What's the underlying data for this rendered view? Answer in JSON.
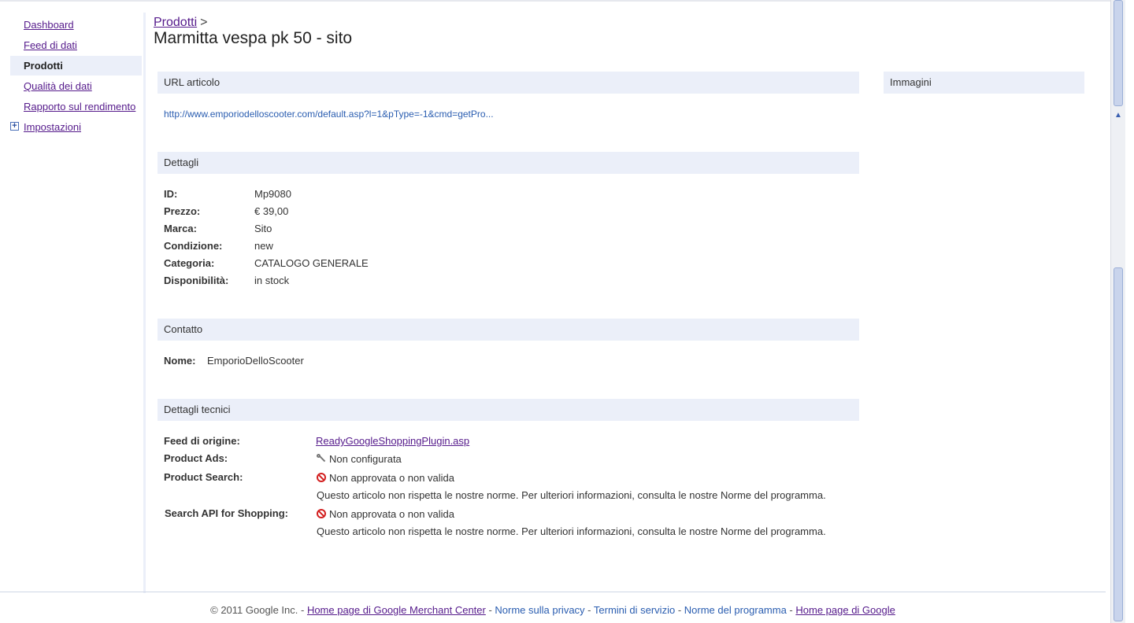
{
  "sidebar": {
    "items": [
      {
        "label": "Dashboard"
      },
      {
        "label": "Feed di dati"
      },
      {
        "label": "Prodotti"
      },
      {
        "label": "Qualità dei dati"
      },
      {
        "label": "Rapporto sul rendimento"
      },
      {
        "label": "Impostazioni"
      }
    ]
  },
  "header": {
    "breadcrumb": "Prodotti",
    "breadcrumb_sep": ">",
    "title": "Marmitta vespa pk 50 - sito"
  },
  "url_section": {
    "title": "URL articolo",
    "url": "http://www.emporiodelloscooter.com/default.asp?l=1&pType=-1&cmd=getPro..."
  },
  "images_section": {
    "title": "Immagini"
  },
  "details": {
    "title": "Dettagli",
    "rows": [
      {
        "label": "ID:",
        "value": "Mp9080"
      },
      {
        "label": "Prezzo:",
        "value": "€ 39,00"
      },
      {
        "label": "Marca:",
        "value": "Sito"
      },
      {
        "label": "Condizione:",
        "value": "new"
      },
      {
        "label": "Categoria:",
        "value": "CATALOGO GENERALE"
      },
      {
        "label": "Disponibilità:",
        "value": "in stock"
      }
    ]
  },
  "contact": {
    "title": "Contatto",
    "label": "Nome:",
    "value": "EmporioDelloScooter"
  },
  "technical": {
    "title": "Dettagli tecnici",
    "feed_label": "Feed di origine:",
    "feed_value": "ReadyGoogleShoppingPlugin.asp",
    "ads_label": "Product Ads:",
    "ads_value": "Non configurata",
    "search_label": "Product Search:",
    "search_value": "Non approvata o non valida",
    "search_note": "Questo articolo non rispetta le nostre norme. Per ulteriori informazioni, consulta le nostre Norme del programma.",
    "api_label": "Search API for Shopping:",
    "api_value": "Non approvata o non valida",
    "api_note": "Questo articolo non rispetta le nostre norme. Per ulteriori informazioni, consulta le nostre Norme del programma."
  },
  "footer": {
    "copyright": "© 2011 Google Inc. -",
    "links": [
      "Home page di Google Merchant Center",
      "Norme sulla privacy",
      "Termini di servizio",
      "Norme del programma",
      "Home page di Google"
    ],
    "sep": " - "
  }
}
